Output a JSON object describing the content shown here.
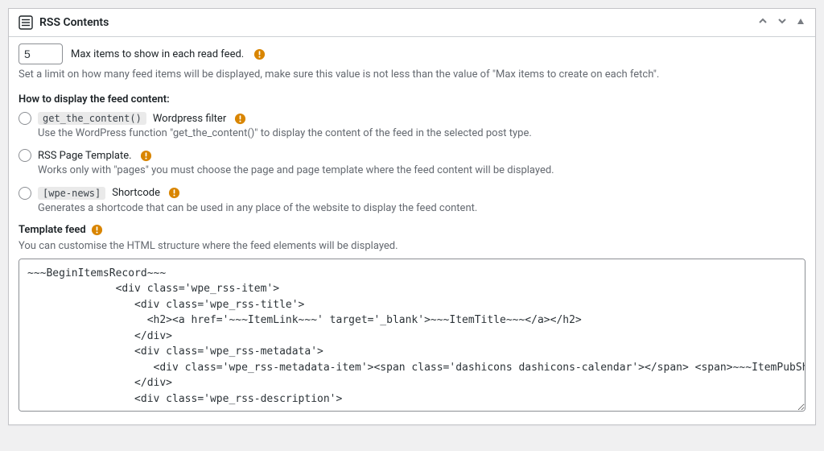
{
  "panel": {
    "title": "RSS Contents"
  },
  "max_items": {
    "value": "5",
    "label": "Max items to show in each read feed.",
    "help": "Set a limit on how many feed items will be displayed, make sure this value is not less than the value of \"Max items to create on each fetch\"."
  },
  "display_mode": {
    "section_label": "How to display the feed content:",
    "options": [
      {
        "code": "get_the_content()",
        "label": "Wordpress filter",
        "desc": "Use the WordPress function \"get_the_content()\" to display the content of the feed in the selected post type."
      },
      {
        "code": "",
        "label": "RSS Page Template.",
        "desc": "Works only with \"pages\" you must choose the page and page template where the feed content will be displayed."
      },
      {
        "code": "[wpe-news]",
        "label": "Shortcode",
        "desc": "Generates a shortcode that can be used in any place of the website to display the feed content."
      }
    ]
  },
  "template": {
    "label": "Template feed",
    "help": "You can customise the HTML structure where the feed elements will be displayed.",
    "value": "~~~BeginItemsRecord~~~\n              <div class='wpe_rss-item'>\n                 <div class='wpe_rss-title'>\n                   <h2><a href='~~~ItemLink~~~' target='_blank'>~~~ItemTitle~~~</a></h2>\n                 </div>\n                 <div class='wpe_rss-metadata'>\n                    <div class='wpe_rss-metadata-item'><span class='dashicons dashicons-calendar'></span> <span>~~~ItemPubShortDate~~~ ~~~ItemPubShortTime~~~</span></div>\n                 </div>\n                 <div class='wpe_rss-description'>"
  }
}
